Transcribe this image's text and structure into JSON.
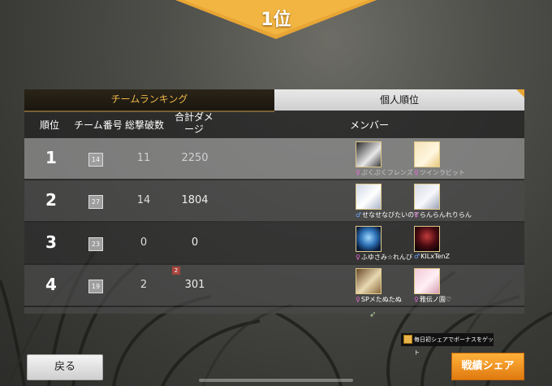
{
  "banner": {
    "rank_label": "1位"
  },
  "tabs": {
    "team_label": "チームランキング",
    "personal_label": "個人順位"
  },
  "columns": {
    "rank": "順位",
    "team_number": "チーム番号",
    "kills": "総撃破数",
    "damage": "合計ダメージ",
    "members": "メンバー"
  },
  "rows": [
    {
      "rank": "1",
      "team": "14",
      "kills": "11",
      "damage": "2250",
      "members": [
        {
          "name": "ぷくぷくフレンズ",
          "gender": "♀"
        },
        {
          "name": "ツインラビット",
          "gender": "♀"
        }
      ]
    },
    {
      "rank": "2",
      "team": "27",
      "kills": "14",
      "damage": "1804",
      "members": [
        {
          "name": "せなせなびたいの??",
          "gender": "♂"
        },
        {
          "name": "らんらんれりらん",
          "gender": "♀"
        }
      ]
    },
    {
      "rank": "3",
      "team": "23",
      "kills": "0",
      "damage": "0",
      "members": [
        {
          "name": "ふゆさみ☆れんび",
          "gender": "♀"
        },
        {
          "name": "KILxTenZ",
          "gender": "♂"
        }
      ]
    },
    {
      "rank": "4",
      "team": "19",
      "kills": "2",
      "damage": "301",
      "members": [
        {
          "name": "SPメたぬたぬ",
          "gender": "♀"
        },
        {
          "name": "雅伝ノ園♡",
          "gender": "♀"
        }
      ]
    }
  ],
  "row4_badge": "2",
  "buttons": {
    "back": "戻る",
    "share": "戦績シェア"
  },
  "share_tip": "毎日初シェアでボーナスをゲット"
}
